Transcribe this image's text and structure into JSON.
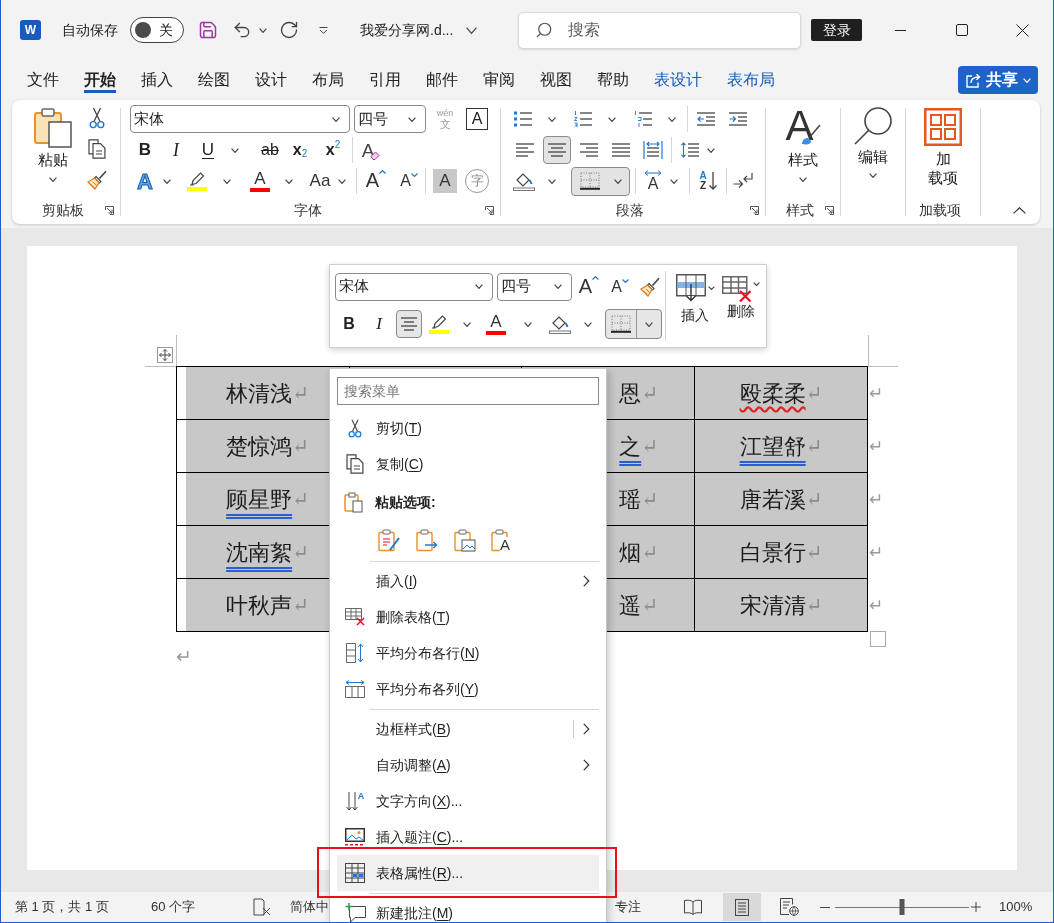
{
  "title_bar": {
    "app_icon": "W",
    "autosave": {
      "label": "自动保存",
      "on": false,
      "state": "关"
    },
    "file_name": "我爱分享网.d...",
    "search": {
      "placeholder": "搜索"
    },
    "sign_in": "登录"
  },
  "tabs": [
    {
      "label": "文件",
      "selected": false,
      "kind": "standard"
    },
    {
      "label": "开始",
      "selected": true,
      "kind": "standard"
    },
    {
      "label": "插入",
      "selected": false,
      "kind": "standard"
    },
    {
      "label": "绘图",
      "selected": false,
      "kind": "standard"
    },
    {
      "label": "设计",
      "selected": false,
      "kind": "standard"
    },
    {
      "label": "布局",
      "selected": false,
      "kind": "standard"
    },
    {
      "label": "引用",
      "selected": false,
      "kind": "standard"
    },
    {
      "label": "邮件",
      "selected": false,
      "kind": "standard"
    },
    {
      "label": "审阅",
      "selected": false,
      "kind": "standard"
    },
    {
      "label": "视图",
      "selected": false,
      "kind": "standard"
    },
    {
      "label": "帮助",
      "selected": false,
      "kind": "standard"
    },
    {
      "label": "表设计",
      "selected": false,
      "kind": "contextual"
    },
    {
      "label": "表布局",
      "selected": false,
      "kind": "contextual"
    }
  ],
  "share_button": {
    "label": "共享"
  },
  "ribbon": {
    "clipboard": {
      "paste": "粘贴",
      "label": "剪贴板"
    },
    "font": {
      "label": "字体",
      "font_name": "宋体",
      "font_size": "四号",
      "phonetic_guide": {
        "pinyin": "wén",
        "character": "文"
      },
      "border_glyph": "A",
      "format_buttons": [
        {
          "kind": "bold",
          "glyph": "B"
        },
        {
          "kind": "italic",
          "glyph": "I"
        },
        {
          "kind": "underline",
          "glyph": "U"
        },
        {
          "kind": "strikethrough",
          "glyph": "ab"
        },
        {
          "kind": "subscript",
          "glyph": "x",
          "index": "2"
        },
        {
          "kind": "superscript",
          "glyph": "x",
          "index": "2"
        },
        {
          "kind": "clear",
          "glyph": "A"
        }
      ],
      "color_buttons": [
        {
          "kind": "effects",
          "glyph": "A"
        },
        {
          "kind": "highlight",
          "color": "#ffff00"
        },
        {
          "kind": "font_color",
          "glyph": "A",
          "color": "#ff0000"
        },
        {
          "kind": "case",
          "glyph": "Aa"
        },
        {
          "kind": "grow",
          "glyph": "A"
        },
        {
          "kind": "shrink",
          "glyph": "A"
        },
        {
          "kind": "shading",
          "glyph": "A"
        },
        {
          "kind": "enclose",
          "glyph": "字"
        }
      ]
    },
    "paragraph": {
      "label": "段落",
      "align_buttons": [
        {
          "kind": "left",
          "selected": false
        },
        {
          "kind": "center",
          "selected": true
        },
        {
          "kind": "right",
          "selected": false
        },
        {
          "kind": "justify",
          "selected": false
        },
        {
          "kind": "distributed",
          "selected": false
        }
      ],
      "borders": {
        "selected": true
      },
      "direction_glyph": "A",
      "sort": {
        "top": "A",
        "bottom": "Z"
      }
    },
    "styles": {
      "glyph": "A",
      "button": "样式",
      "label": "样式"
    },
    "editing": {
      "button": "编辑"
    },
    "addins": {
      "button_lines": [
        "加",
        "载项"
      ],
      "label": "加载项"
    }
  },
  "document": {
    "table": {
      "rows": [
        {
          "cells": [
            {
              "text": "林清浅",
              "mark": "↵",
              "spelling_error": false,
              "grammar_error": false
            },
            {
              "text": "恩",
              "mark": "↵",
              "spelling_error": false,
              "grammar_error": false
            },
            {
              "text": "殴柔柔",
              "mark": "↵",
              "spelling_error": true,
              "grammar_error": false
            }
          ],
          "end_mark": "↵"
        },
        {
          "cells": [
            {
              "text": "楚惊鸿",
              "mark": "↵",
              "spelling_error": false,
              "grammar_error": false
            },
            {
              "text": "之",
              "mark": "↵",
              "spelling_error": false,
              "grammar_error": true
            },
            {
              "text": "江望舒",
              "mark": "↵",
              "spelling_error": false,
              "grammar_error": true
            }
          ],
          "end_mark": "↵"
        },
        {
          "cells": [
            {
              "text": "顾星野",
              "mark": "↵",
              "spelling_error": false,
              "grammar_error": true
            },
            {
              "text": "瑶",
              "mark": "↵",
              "spelling_error": false,
              "grammar_error": false
            },
            {
              "text": "唐若溪",
              "mark": "↵",
              "spelling_error": false,
              "grammar_error": false
            }
          ],
          "end_mark": "↵"
        },
        {
          "cells": [
            {
              "text": "沈南絮",
              "mark": "↵",
              "spelling_error": false,
              "grammar_error": true
            },
            {
              "text": "烟",
              "mark": "↵",
              "spelling_error": false,
              "grammar_error": false
            },
            {
              "text": "白景行",
              "mark": "↵",
              "spelling_error": false,
              "grammar_error": false
            }
          ],
          "end_mark": "↵"
        },
        {
          "cells": [
            {
              "text": "叶秋声",
              "mark": "↵",
              "spelling_error": false,
              "grammar_error": false
            },
            {
              "text": "遥",
              "mark": "↵",
              "spelling_error": false,
              "grammar_error": false
            },
            {
              "text": "宋清清",
              "mark": "↵",
              "spelling_error": false,
              "grammar_error": false
            }
          ],
          "end_mark": "↵"
        }
      ]
    },
    "paragraph_mark": "↵"
  },
  "mini_toolbar": {
    "font_name": "宋体",
    "font_size": "四号",
    "grow_glyph": "A",
    "shrink_glyph": "A",
    "buttons": [
      {
        "kind": "bold",
        "glyph": "B",
        "pressed": false
      },
      {
        "kind": "italic",
        "glyph": "I",
        "pressed": false
      },
      {
        "kind": "center",
        "pressed": true
      },
      {
        "kind": "highlight",
        "color": "#ffff00",
        "pressed": false
      },
      {
        "kind": "font_color",
        "glyph": "A",
        "color": "#ff0000",
        "pressed": false
      },
      {
        "kind": "shading",
        "pressed": false
      },
      {
        "kind": "borders",
        "pressed": true
      }
    ],
    "insert": "插入",
    "delete": "删除"
  },
  "context_menu": {
    "search": {
      "placeholder": "搜索菜单"
    },
    "items": [
      {
        "kind": "command",
        "label": "剪切(",
        "key": "T",
        "tail": ")",
        "highlighted": false,
        "framed": false
      },
      {
        "kind": "command",
        "label": "复制(",
        "key": "C",
        "tail": ")",
        "highlighted": false,
        "framed": false
      },
      {
        "kind": "header",
        "label": "粘贴选项:"
      },
      {
        "kind": "paste_options",
        "text_glyph": "A"
      },
      {
        "kind": "separator"
      },
      {
        "kind": "submenu",
        "label": "插入(",
        "key": "I",
        "tail": ")",
        "highlighted": false,
        "framed": false
      },
      {
        "kind": "command",
        "label": "删除表格(",
        "key": "T",
        "tail": ")",
        "highlighted": false,
        "framed": false
      },
      {
        "kind": "command",
        "label": "平均分布各行(",
        "key": "N",
        "tail": ")",
        "highlighted": false,
        "framed": false
      },
      {
        "kind": "command",
        "label": "平均分布各列(",
        "key": "Y",
        "tail": ")",
        "highlighted": false,
        "framed": false
      },
      {
        "kind": "separator"
      },
      {
        "kind": "split_submenu",
        "label": "边框样式(",
        "key": "B",
        "tail": ")",
        "highlighted": false,
        "framed": false
      },
      {
        "kind": "submenu",
        "label": "自动调整(",
        "key": "A",
        "tail": ")",
        "highlighted": false,
        "framed": false
      },
      {
        "kind": "command",
        "label": "文字方向(",
        "key": "X",
        "tail": ")...",
        "highlighted": false,
        "framed": false,
        "icon_glyph": "A"
      },
      {
        "kind": "command",
        "label": "插入题注(",
        "key": "C",
        "tail": ")...",
        "highlighted": false,
        "framed": false
      },
      {
        "kind": "command",
        "label": "表格属性(",
        "key": "R",
        "tail": ")...",
        "highlighted": true,
        "framed": true
      },
      {
        "kind": "separator"
      },
      {
        "kind": "command",
        "label": "新建批注(",
        "key": "M",
        "tail": ")",
        "highlighted": false,
        "framed": false
      }
    ]
  },
  "status_bar": {
    "page": "第 1 页，共 1 页",
    "words": "60 个字",
    "language": "简体中",
    "focus": "专注",
    "views": [
      {
        "kind": "read",
        "selected": false
      },
      {
        "kind": "print",
        "selected": true
      },
      {
        "kind": "web",
        "selected": false
      }
    ],
    "zoom": {
      "level": 0.5,
      "reading": "100%"
    }
  }
}
